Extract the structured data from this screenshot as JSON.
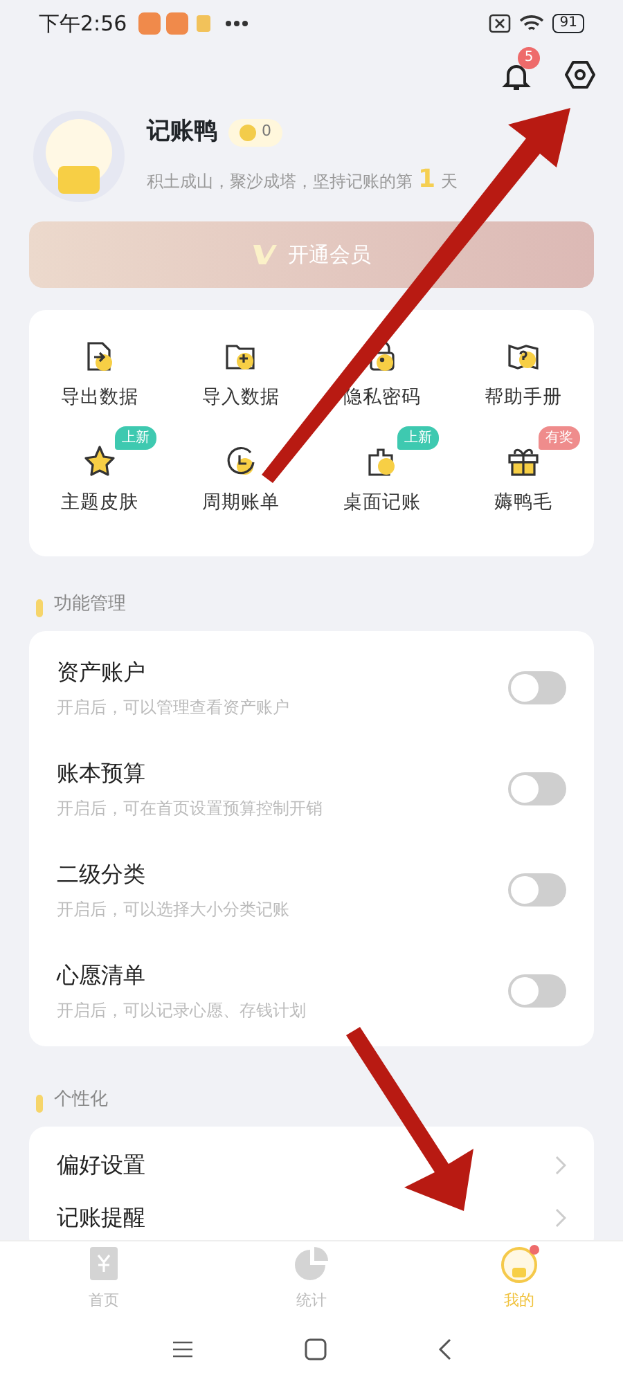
{
  "status_bar": {
    "time": "下午2:56",
    "battery": "91"
  },
  "header": {
    "notification_count": "5"
  },
  "profile": {
    "name": "记账鸭",
    "coins": "0",
    "motto": "积土成山，聚沙成塔，坚持记账的第",
    "days": "1",
    "days_unit": "天"
  },
  "vip_button": {
    "label": "开通会员"
  },
  "shortcuts": [
    {
      "label": "导出数据"
    },
    {
      "label": "导入数据"
    },
    {
      "label": "隐私密码"
    },
    {
      "label": "帮助手册"
    },
    {
      "label": "主题皮肤",
      "badge": "上新",
      "color": "#3ec9b0"
    },
    {
      "label": "周期账单"
    },
    {
      "label": "桌面记账",
      "badge": "上新",
      "color": "#3ec9b0"
    },
    {
      "label": "薅鸭毛",
      "badge": "有奖",
      "color": "#ef8c8c"
    }
  ],
  "sections": [
    {
      "title": "功能管理",
      "kind": "toggles",
      "items": [
        {
          "title": "资产账户",
          "subtitle": "开启后，可以管理查看资产账户",
          "on": false
        },
        {
          "title": "账本预算",
          "subtitle": "开启后，可在首页设置预算控制开销",
          "on": false
        },
        {
          "title": "二级分类",
          "subtitle": "开启后，可以选择大小分类记账",
          "on": false
        },
        {
          "title": "心愿清单",
          "subtitle": "开启后，可以记录心愿、存钱计划",
          "on": false
        }
      ]
    },
    {
      "title": "个性化",
      "kind": "links",
      "items": [
        {
          "title": "偏好设置"
        },
        {
          "title": "记账提醒"
        }
      ]
    }
  ],
  "tabs": [
    {
      "label": "首页",
      "selected": false,
      "dot": false
    },
    {
      "label": "统计",
      "selected": false,
      "dot": false
    },
    {
      "label": "我的",
      "selected": true,
      "dot": true
    }
  ]
}
